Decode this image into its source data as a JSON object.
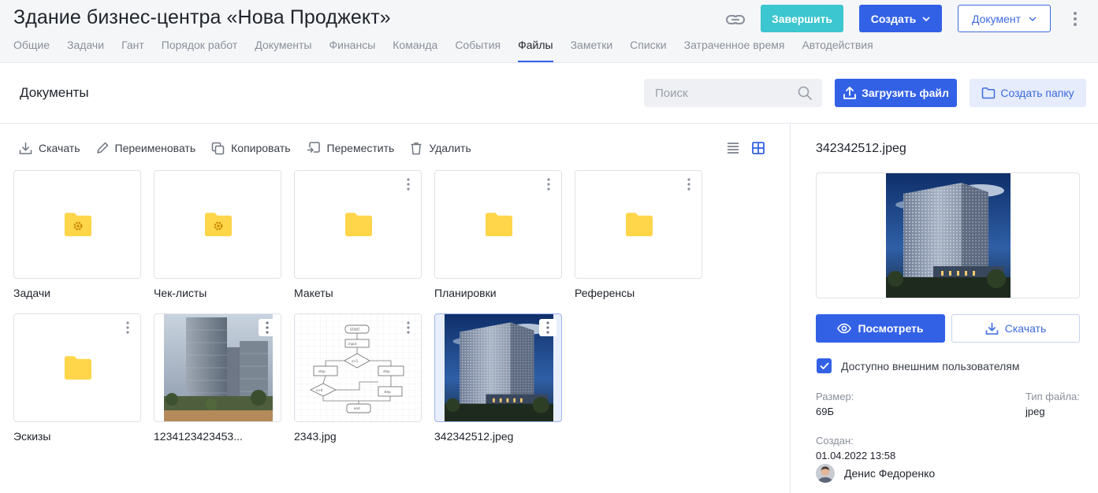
{
  "header": {
    "title": "Здание бизнес-центра «Нова Проджект»",
    "finish_label": "Завершить",
    "create_label": "Создать",
    "document_label": "Документ",
    "tabs": [
      {
        "label": "Общие"
      },
      {
        "label": "Задачи"
      },
      {
        "label": "Гант"
      },
      {
        "label": "Порядок работ"
      },
      {
        "label": "Документы"
      },
      {
        "label": "Финансы"
      },
      {
        "label": "Команда"
      },
      {
        "label": "События"
      },
      {
        "label": "Файлы",
        "active": true
      },
      {
        "label": "Заметки"
      },
      {
        "label": "Списки"
      },
      {
        "label": "Затраченное время"
      },
      {
        "label": "Автодействия"
      }
    ]
  },
  "section": {
    "title": "Документы",
    "search_placeholder": "Поиск",
    "upload_label": "Загрузить файл",
    "new_folder_label": "Создать папку"
  },
  "toolbar": {
    "download": "Скачать",
    "rename": "Переименовать",
    "copy": "Копировать",
    "move": "Переместить",
    "delete": "Удалить"
  },
  "items": [
    {
      "name": "Задачи",
      "kind": "system-folder"
    },
    {
      "name": "Чек-листы",
      "kind": "system-folder"
    },
    {
      "name": "Макеты",
      "kind": "folder"
    },
    {
      "name": "Планировки",
      "kind": "folder"
    },
    {
      "name": "Референсы",
      "kind": "folder"
    },
    {
      "name": "Эскизы",
      "kind": "folder"
    },
    {
      "name": "1234123423453...",
      "kind": "image-towers"
    },
    {
      "name": "2343.jpg",
      "kind": "image-flowchart"
    },
    {
      "name": "342342512.jpeg",
      "kind": "image-building",
      "selected": true
    }
  ],
  "panel": {
    "file_name": "342342512.jpeg",
    "view_label": "Посмотреть",
    "download_label": "Скачать",
    "external_access_label": "Доступно внешним пользователям",
    "external_access_checked": true,
    "size_label": "Размер:",
    "size_value": "69Б",
    "type_label": "Тип файла:",
    "type_value": "jpeg",
    "created_label": "Создан:",
    "created_value": "01.04.2022 13:58",
    "author": "Денис Федоренко"
  },
  "colors": {
    "primary": "#3361e6",
    "teal": "#3cc6cf",
    "folder": "#ffd54a"
  }
}
